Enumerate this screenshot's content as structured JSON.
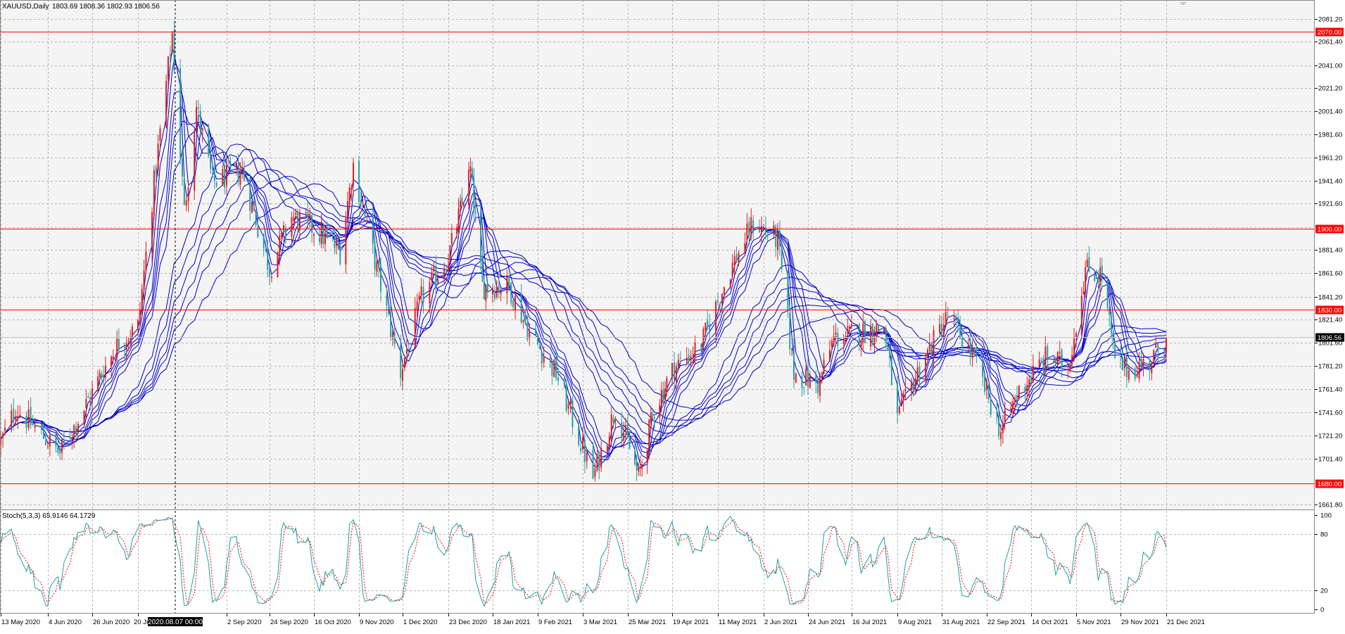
{
  "header": {
    "symbol_label": "XAUUSD,Daily",
    "ohlc_text": "1803.69 1808.36 1802.93 1806.56"
  },
  "crosshair_date": "2020.08.07 00:00",
  "price_tag": "1806.56",
  "colors": {
    "background": "#f4f4f4",
    "grid": "#b4b4b4",
    "bull_candle": "#e02020",
    "bear_candle": "#2aa0a0",
    "moving_averages": "#0000cc",
    "hlines": "#ff0000",
    "stoch_main": "#20a0a0",
    "stoch_signal": "#ff0000"
  },
  "chart_data": [
    {
      "type": "candlestick",
      "title": "XAUUSD,Daily",
      "ylim": [
        1661.8,
        2091.0
      ],
      "y_ticks": [
        "2081.20",
        "2061.40",
        "2041.00",
        "2021.20",
        "2001.40",
        "1981.60",
        "1961.20",
        "1941.40",
        "1921.60",
        "1901.20",
        "1881.40",
        "1861.60",
        "1841.20",
        "1821.40",
        "1801.60",
        "1781.20",
        "1761.40",
        "1741.60",
        "1721.20",
        "1701.40",
        "1680.00",
        "1661.80"
      ],
      "x_ticks": [
        "13 May 2020",
        "4 Jun 2020",
        "26 Jun 2020",
        "20 Jul 2020",
        "2 Sep 2020",
        "24 Sep 2020",
        "16 Oct 2020",
        "9 Nov 2020",
        "1 Dec 2020",
        "23 Dec 2020",
        "18 Jan 2021",
        "9 Feb 2021",
        "3 Mar 2021",
        "25 Mar 2021",
        "19 Apr 2021",
        "11 May 2021",
        "2 Jun 2021",
        "24 Jun 2021",
        "16 Jul 2021",
        "9 Aug 2021",
        "31 Aug 2021",
        "22 Sep 2021",
        "14 Oct 2021",
        "5 Nov 2021",
        "29 Nov 2021",
        "21 Dec 2021"
      ],
      "horizontal_levels": [
        {
          "label": "2070.00",
          "value": 2070.0
        },
        {
          "label": "1900.00",
          "value": 1900.0
        },
        {
          "label": "1830.00",
          "value": 1830.0
        },
        {
          "label": "1680.00",
          "value": 1680.0
        }
      ],
      "last_price": 1806.56,
      "close_path": [
        {
          "date": "2020-05-13",
          "close": 1715
        },
        {
          "date": "2020-05-20",
          "close": 1745
        },
        {
          "date": "2020-06-01",
          "close": 1722
        },
        {
          "date": "2020-06-10",
          "close": 1706
        },
        {
          "date": "2020-06-22",
          "close": 1745
        },
        {
          "date": "2020-07-01",
          "close": 1775
        },
        {
          "date": "2020-07-10",
          "close": 1802
        },
        {
          "date": "2020-07-20",
          "close": 1815
        },
        {
          "date": "2020-07-28",
          "close": 1940
        },
        {
          "date": "2020-08-06",
          "close": 2068
        },
        {
          "date": "2020-08-12",
          "close": 1915
        },
        {
          "date": "2020-08-18",
          "close": 2005
        },
        {
          "date": "2020-08-26",
          "close": 1940
        },
        {
          "date": "2020-09-02",
          "close": 1945
        },
        {
          "date": "2020-09-10",
          "close": 1950
        },
        {
          "date": "2020-09-24",
          "close": 1865
        },
        {
          "date": "2020-10-05",
          "close": 1910
        },
        {
          "date": "2020-10-16",
          "close": 1900
        },
        {
          "date": "2020-10-30",
          "close": 1880
        },
        {
          "date": "2020-11-06",
          "close": 1955
        },
        {
          "date": "2020-11-16",
          "close": 1880
        },
        {
          "date": "2020-11-30",
          "close": 1776
        },
        {
          "date": "2020-12-10",
          "close": 1840
        },
        {
          "date": "2020-12-23",
          "close": 1875
        },
        {
          "date": "2021-01-05",
          "close": 1950
        },
        {
          "date": "2021-01-12",
          "close": 1850
        },
        {
          "date": "2021-01-26",
          "close": 1850
        },
        {
          "date": "2021-02-05",
          "close": 1810
        },
        {
          "date": "2021-02-18",
          "close": 1775
        },
        {
          "date": "2021-03-08",
          "close": 1685
        },
        {
          "date": "2021-03-19",
          "close": 1745
        },
        {
          "date": "2021-03-31",
          "close": 1685
        },
        {
          "date": "2021-04-09",
          "close": 1745
        },
        {
          "date": "2021-04-20",
          "close": 1780
        },
        {
          "date": "2021-05-03",
          "close": 1800
        },
        {
          "date": "2021-05-17",
          "close": 1865
        },
        {
          "date": "2021-05-28",
          "close": 1905
        },
        {
          "date": "2021-06-09",
          "close": 1890
        },
        {
          "date": "2021-06-17",
          "close": 1775
        },
        {
          "date": "2021-06-29",
          "close": 1765
        },
        {
          "date": "2021-07-07",
          "close": 1805
        },
        {
          "date": "2021-07-20",
          "close": 1810
        },
        {
          "date": "2021-08-02",
          "close": 1815
        },
        {
          "date": "2021-08-09",
          "close": 1735
        },
        {
          "date": "2021-08-20",
          "close": 1780
        },
        {
          "date": "2021-09-03",
          "close": 1825
        },
        {
          "date": "2021-09-15",
          "close": 1790
        },
        {
          "date": "2021-09-29",
          "close": 1725
        },
        {
          "date": "2021-10-08",
          "close": 1760
        },
        {
          "date": "2021-10-22",
          "close": 1790
        },
        {
          "date": "2021-11-01",
          "close": 1780
        },
        {
          "date": "2021-11-10",
          "close": 1865
        },
        {
          "date": "2021-11-19",
          "close": 1860
        },
        {
          "date": "2021-11-26",
          "close": 1785
        },
        {
          "date": "2021-12-03",
          "close": 1778
        },
        {
          "date": "2021-12-13",
          "close": 1785
        },
        {
          "date": "2021-12-17",
          "close": 1795
        },
        {
          "date": "2021-12-21",
          "close": 1806.56
        }
      ]
    },
    {
      "type": "line",
      "title": "Stoch(5,3,3) 65.9146 64.1729",
      "ylim": [
        0,
        100
      ],
      "y_ticks": [
        "100",
        "80",
        "20",
        "0"
      ],
      "levels": [
        80,
        20
      ],
      "series": [
        {
          "name": "Stoch(5,3,3)",
          "last_value": 65.9146
        },
        {
          "name": "signal",
          "last_value": 64.1729
        }
      ]
    }
  ]
}
